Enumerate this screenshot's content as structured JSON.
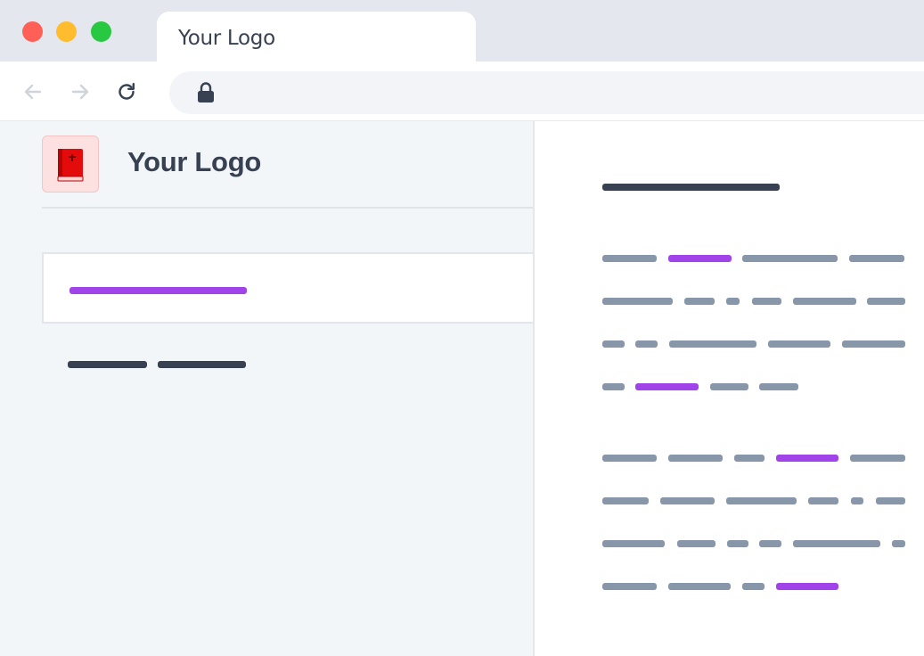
{
  "window": {
    "traffic_lights": [
      "close",
      "minimize",
      "zoom"
    ],
    "colors": {
      "close": "#fe5f57",
      "minimize": "#febc2e",
      "zoom": "#28c840"
    }
  },
  "tab": {
    "title": "Your Logo"
  },
  "toolbar": {
    "back_icon": "arrow-left-icon",
    "forward_icon": "arrow-right-icon",
    "reload_icon": "reload-icon",
    "lock_icon": "lock-icon",
    "address_text": ""
  },
  "sidebar": {
    "logo_icon": "red-book-icon",
    "logo_text": "Your Logo"
  },
  "colors": {
    "sidebar_bg": "#f3f6f9",
    "text_placeholder": "#8896aa",
    "link_placeholder": "#a043e8",
    "heading_placeholder": "#374151"
  }
}
